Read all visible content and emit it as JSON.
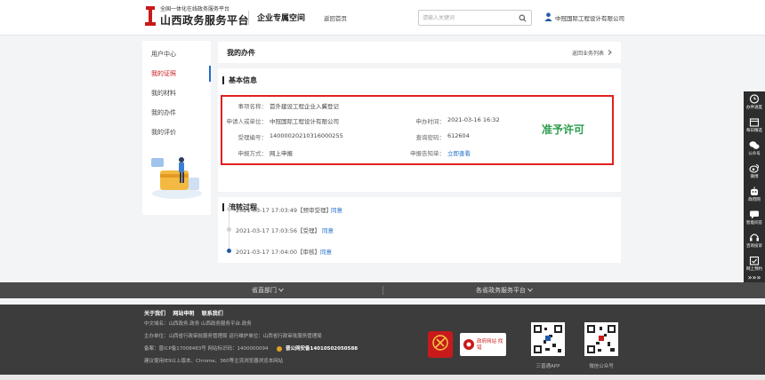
{
  "header": {
    "logo_sub": "全国一体化在线政务服务平台",
    "logo_main": "山西政务服务平台",
    "space_title": "企业专属空间",
    "home_link": "返回首页",
    "search_placeholder": "请输入关键词",
    "user_name": "中冠国际工程设计有限公司"
  },
  "sidebar": {
    "items": [
      {
        "label": "用户中心"
      },
      {
        "label": "我的证照"
      },
      {
        "label": "我的材料"
      },
      {
        "label": "我的办件"
      },
      {
        "label": "我的评价"
      }
    ]
  },
  "main": {
    "panel_title": "我的办件",
    "return_link": "返回业务列表",
    "basic_info_title": "基本信息",
    "fields": {
      "matter_label": "事项名称：",
      "matter_value": "首外建设工程企业入冀登记",
      "applicant_label": "申请人或单位：",
      "applicant_value": "中冠国际工程设计有限公司",
      "apply_time_label": "申办时间：",
      "apply_time_value": "2021-03-16 16:32",
      "number_label": "受理编号：",
      "number_value": "14000020210316000255",
      "query_pwd_label": "查询密码：",
      "query_pwd_value": "612604",
      "method_label": "申报方式：",
      "method_value": "网上申报",
      "result_label": "申报告知单：",
      "result_value": "立即查看"
    },
    "status": "准予许可",
    "flow_title": "流转过程",
    "timeline": [
      {
        "time": "2021-03-17 17:03:49",
        "step": "【预审受理】",
        "result": "同意"
      },
      {
        "time": "2021-03-17 17:03:56",
        "step": "【受理】",
        "result": "同意"
      },
      {
        "time": "2021-03-17 17:04:00",
        "step": "【审核】",
        "result": "同意"
      }
    ]
  },
  "float_bar": {
    "items": [
      {
        "label": "办件进度",
        "icon": "clock-icon"
      },
      {
        "label": "每日精选",
        "icon": "calendar-icon"
      },
      {
        "label": "公众号",
        "icon": "wechat-icon"
      },
      {
        "label": "微博",
        "icon": "weibo-icon"
      },
      {
        "label": "政府网",
        "icon": "robot-icon"
      },
      {
        "label": "智能问答",
        "icon": "chat-icon"
      },
      {
        "label": "咨询投诉",
        "icon": "headset-icon"
      },
      {
        "label": "网上预约",
        "icon": "booking-icon"
      }
    ],
    "more": "»»»"
  },
  "footer": {
    "tab_left": "省直部门",
    "tab_right": "各省政务服务平台",
    "links": "关于我们    网站申明    联系我们",
    "line1": "中文域名：山西政务.政务    山西政务服务平台.政务",
    "line2": "主办单位：山西省行政审批服务管理局      运行维护单位：山西省行政审批服务管理局",
    "line3": "备案：晋ICP备17008483号      网站标识码：1400000094",
    "line3_police": "晋公网安备14010502050588",
    "line4": "建议使用IE9以上版本、Chrome、360等主流浏览器浏览本网站",
    "badge2_text": "政府网站 找错",
    "qr1_label": "三晋通APP",
    "qr2_label": "微信公众号"
  },
  "colors": {
    "accent_red": "#c81a1a",
    "frame_red": "#e02020",
    "link_blue": "#1f6ec9",
    "status_green": "#2a9d4b",
    "footer_dark": "#3c3c3c"
  }
}
